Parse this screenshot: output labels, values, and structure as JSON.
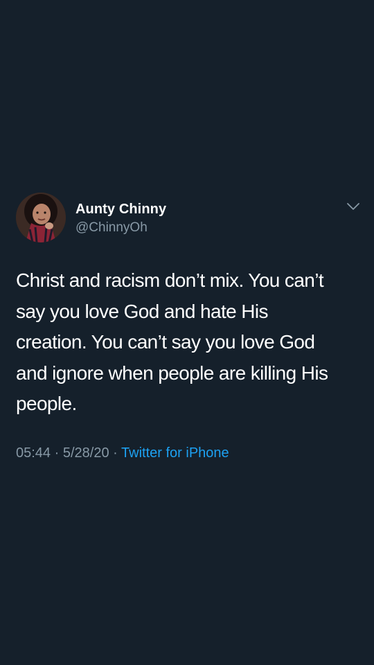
{
  "tweet": {
    "author": {
      "display_name": "Aunty Chinny",
      "handle": "@ChinnyOh",
      "avatar_icon": "profile-photo"
    },
    "menu_icon": "chevron-down-icon",
    "text": "Christ and racism don’t mix. You can’t\nsay you love God and hate His\ncreation. You can’t say you love God\nand ignore when people are killing His\npeople.",
    "time": "05:44",
    "separator_1": "·",
    "date": "5/28/20",
    "separator_2": "·",
    "source": "Twitter for iPhone"
  },
  "colors": {
    "background": "#15202b",
    "primary_text": "#ffffff",
    "secondary_text": "#8899a6",
    "link": "#1da1f2"
  }
}
